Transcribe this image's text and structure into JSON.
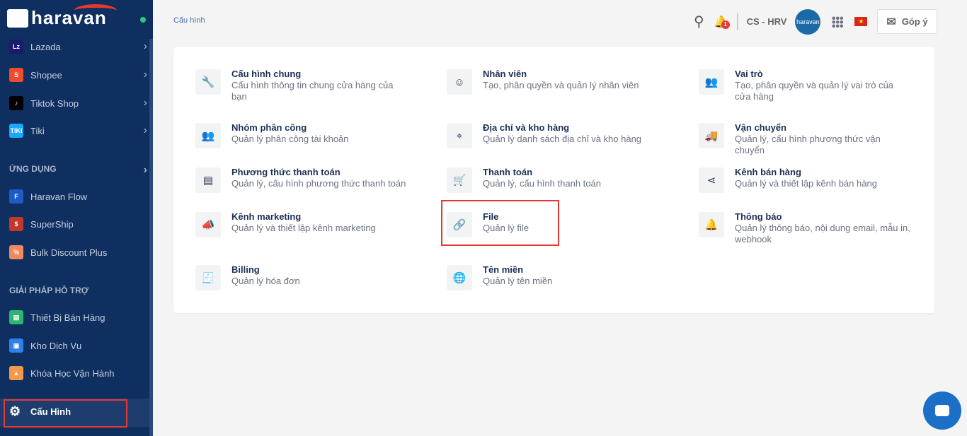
{
  "brand": {
    "logo": "haravan"
  },
  "sidebar": {
    "channels": [
      {
        "label": "Lazada",
        "color": "#1a1a6e",
        "abbr": "Lz"
      },
      {
        "label": "Shopee",
        "color": "#ee4d2d",
        "abbr": "S"
      },
      {
        "label": "Tiktok Shop",
        "color": "#000000",
        "abbr": "♪"
      },
      {
        "label": "Tiki",
        "color": "#1ba8ff",
        "abbr": "TIKI"
      }
    ],
    "apps_header": "ỨNG DỤNG",
    "apps": [
      {
        "label": "Haravan Flow",
        "color": "#1e5bc6",
        "abbr": "F"
      },
      {
        "label": "SuperShip",
        "color": "#c0392b",
        "abbr": "$"
      },
      {
        "label": "Bulk Discount Plus",
        "color": "#f08a5d",
        "abbr": "%"
      }
    ],
    "support_header": "GIẢI PHÁP HỖ TRỢ",
    "support": [
      {
        "label": "Thiết Bị Bán Hàng",
        "color": "#2bb673",
        "abbr": "▤"
      },
      {
        "label": "Kho Dịch Vụ",
        "color": "#2f80ed",
        "abbr": "▣"
      },
      {
        "label": "Khóa Học Vận Hành",
        "color": "#f2994a",
        "abbr": "▲"
      }
    ],
    "active": "Cấu Hình"
  },
  "breadcrumb": "Cấu hình",
  "topbar": {
    "notif_count": "1",
    "account": "CS - HRV",
    "avatar_text": "haravan",
    "feedback": "Góp ý"
  },
  "settings": [
    {
      "title": "Cấu hình chung",
      "desc": "Cấu hình thông tin chung cửa hàng của bạn",
      "icon": "🔧"
    },
    {
      "title": "Nhân viên",
      "desc": "Tạo, phân quyền và quản lý nhân viên",
      "icon": "☺"
    },
    {
      "title": "Vai trò",
      "desc": "Tạo, phân quyền và quản lý vai trò của cửa hàng",
      "icon": "👥"
    },
    {
      "title": "Nhóm phân công",
      "desc": "Quản lý phân công tài khoản",
      "icon": "👥"
    },
    {
      "title": "Địa chỉ và kho hàng",
      "desc": "Quản lý danh sách địa chỉ và kho hàng",
      "icon": "⌖"
    },
    {
      "title": "Vận chuyển",
      "desc": "Quản lý, cấu hình phương thức vận chuyển",
      "icon": "🚚"
    },
    {
      "title": "Phương thức thanh toán",
      "desc": "Quản lý, cấu hình phương thức thanh toán",
      "icon": "▤"
    },
    {
      "title": "Thanh toán",
      "desc": "Quản lý, cấu hình thanh toán",
      "icon": "🛒"
    },
    {
      "title": "Kênh bán hàng",
      "desc": "Quản lý và thiết lập kênh bán hàng",
      "icon": "⋖"
    },
    {
      "title": "Kênh marketing",
      "desc": "Quản lý và thiết lập kênh marketing",
      "icon": "📣"
    },
    {
      "title": "File",
      "desc": "Quản lý file",
      "icon": "🔗"
    },
    {
      "title": "Thông báo",
      "desc": "Quản lý thông báo, nội dung email, mẫu in, webhook",
      "icon": "🔔"
    },
    {
      "title": "Billing",
      "desc": "Quản lý hóa đơn",
      "icon": "🧾"
    },
    {
      "title": "Tên miền",
      "desc": "Quản lý tên miền",
      "icon": "🌐"
    }
  ]
}
